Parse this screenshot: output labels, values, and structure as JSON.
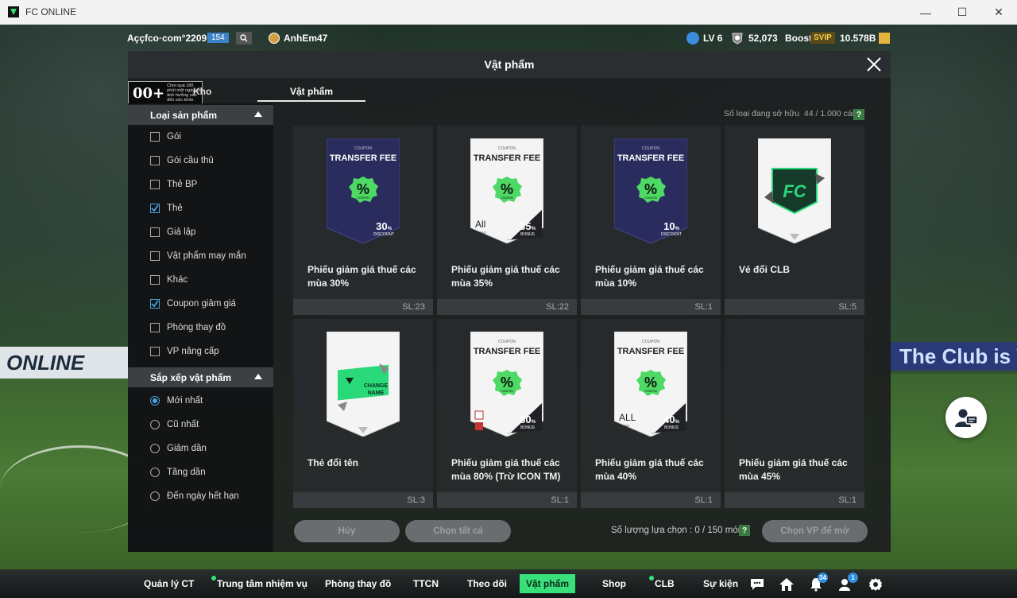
{
  "window": {
    "title": "FC ONLINE",
    "controls": {
      "minimize": "—",
      "maximize": "☐",
      "close": "✕"
    }
  },
  "background": {
    "banner_left": "ONLINE",
    "banner_right": "The Club is Y"
  },
  "hud": {
    "account": "Aççfco·com°2209i",
    "account_badge": "154",
    "username": "AnhEm47",
    "level": "LV 6",
    "coins": "52,073",
    "boost_label": "Boost",
    "svip": "SVIP",
    "bp": "10.578B"
  },
  "modal": {
    "title": "Vật phẩm",
    "age_rating": "00+",
    "age_text": "Chơi quá 180 phút một ngày sẽ ảnh hưởng xấu đến sức khỏe.",
    "tabs": {
      "storage": "Kho",
      "items": "Vật phẩm"
    },
    "owned_label": "Số loại đang sở hữu",
    "owned_value": "44 / 1.000 cái",
    "help": "?"
  },
  "sidebar": {
    "product_type_header": "Loại sản phẩm",
    "product_types": [
      {
        "label": "Gói",
        "checked": false
      },
      {
        "label": "Gói cầu thủ",
        "checked": false
      },
      {
        "label": "Thẻ BP",
        "checked": false
      },
      {
        "label": "Thẻ",
        "checked": true
      },
      {
        "label": "Giả lập",
        "checked": false
      },
      {
        "label": "Vật phẩm may mắn",
        "checked": false
      },
      {
        "label": "Khác",
        "checked": false
      },
      {
        "label": "Coupon giảm giá",
        "checked": true
      },
      {
        "label": "Phòng thay đồ",
        "checked": false
      },
      {
        "label": "VP nâng cấp",
        "checked": false
      }
    ],
    "sort_header": "Sắp xếp vật phẩm",
    "sort_options": [
      {
        "label": "Mới nhất",
        "selected": true
      },
      {
        "label": "Cũ nhất",
        "selected": false
      },
      {
        "label": "Giảm dần",
        "selected": false
      },
      {
        "label": "Tăng dần",
        "selected": false
      },
      {
        "label": "Đến ngày hết hạn",
        "selected": false
      }
    ]
  },
  "items": [
    {
      "name": "Phiếu giảm giá thuế các mùa 30%",
      "qty": "SL:23",
      "card": {
        "style": "dark",
        "top": "COUPON",
        "title": "TRANSFER FEE",
        "pct": "30",
        "sub": "DISCOUNT",
        "extra": ""
      }
    },
    {
      "name": "Phiếu giảm giá thuế các mùa 35%",
      "qty": "SL:22",
      "card": {
        "style": "light",
        "top": "COUPON",
        "title": "TRANSFER FEE",
        "pct": "35",
        "sub": "BONUS",
        "extra": "All"
      }
    },
    {
      "name": "Phiếu giảm giá thuế các mùa 10%",
      "qty": "SL:1",
      "card": {
        "style": "dark",
        "top": "COUPON",
        "title": "TRANSFER FEE",
        "pct": "10",
        "sub": "DISCOUNT",
        "extra": ""
      }
    },
    {
      "name": "Vé đổi CLB",
      "qty": "SL:5",
      "card": {
        "style": "club",
        "top": "",
        "title": "",
        "pct": "",
        "sub": "",
        "extra": ""
      }
    },
    {
      "name": "Thẻ đổi tên",
      "qty": "SL:3",
      "card": {
        "style": "rename",
        "top": "",
        "title": "CHANGE NAME",
        "pct": "",
        "sub": "",
        "extra": ""
      }
    },
    {
      "name": "Phiếu giảm giá thuế các mùa 80% (Trừ ICON TM)",
      "qty": "SL:1",
      "card": {
        "style": "light",
        "top": "COUPON",
        "title": "TRANSFER FEE",
        "pct": "80",
        "sub": "BONUS",
        "extra": "icon"
      }
    },
    {
      "name": "Phiếu giảm giá thuế các mùa 40%",
      "qty": "SL:1",
      "card": {
        "style": "light",
        "top": "COUPON",
        "title": "TRANSFER FEE",
        "pct": "40",
        "sub": "BONUS",
        "extra": "ALL"
      }
    },
    {
      "name": "Phiếu giảm giá thuế các mùa 45%",
      "qty": "SL:1",
      "card": {
        "style": "none",
        "top": "",
        "title": "",
        "pct": "",
        "sub": "",
        "extra": ""
      }
    }
  ],
  "footer": {
    "cancel": "Hủy",
    "select_all": "Chọn tất cả",
    "selection_label": "Số lượng lựa chọn : 0 / 150 món",
    "help": "?",
    "choose": "Chọn VP để mở"
  },
  "bottom_nav": {
    "items": [
      {
        "label": "Quản lý CT",
        "dot": false,
        "active": false
      },
      {
        "label": "Trung tâm nhiệm vụ",
        "dot": true,
        "active": false
      },
      {
        "label": "Phòng thay đồ",
        "dot": false,
        "active": false
      },
      {
        "label": "TTCN",
        "dot": false,
        "active": false
      },
      {
        "label": "Theo dõi",
        "dot": false,
        "active": false
      },
      {
        "label": "Vật phẩm",
        "dot": false,
        "active": true
      },
      {
        "label": "Shop",
        "dot": false,
        "active": false
      },
      {
        "label": "CLB",
        "dot": true,
        "active": false
      },
      {
        "label": "Sự kiện",
        "dot": false,
        "active": false
      }
    ],
    "icons": [
      {
        "name": "chat-icon",
        "badge": ""
      },
      {
        "name": "home-icon",
        "badge": ""
      },
      {
        "name": "bell-icon",
        "badge": "34"
      },
      {
        "name": "friends-icon",
        "badge": "1"
      },
      {
        "name": "settings-icon",
        "badge": ""
      }
    ]
  },
  "colors": {
    "accent": "#38e07a",
    "checkbox": "#4aa3df",
    "coupon_green": "#4cd964",
    "card_dark": "#2b2c5e"
  }
}
